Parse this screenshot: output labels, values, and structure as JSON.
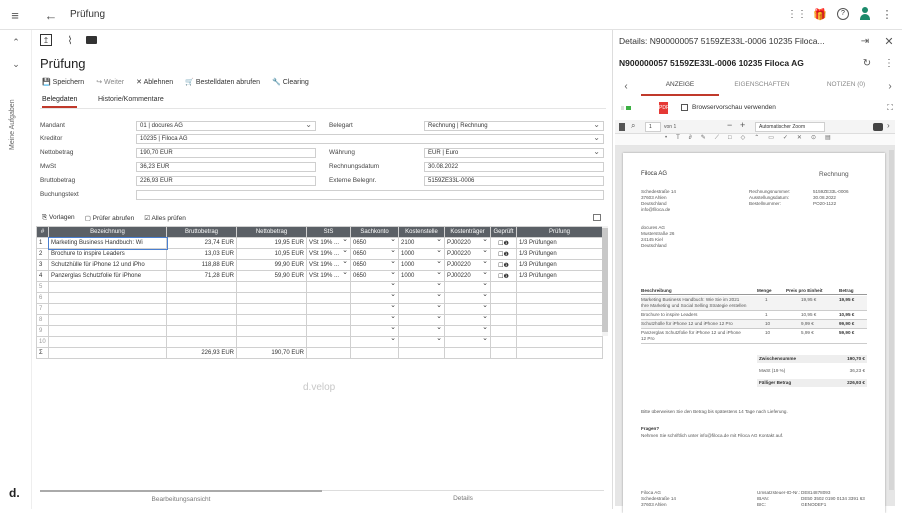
{
  "topbar": {
    "menu_icon": "menu-icon",
    "back_icon": "arrow-left-icon",
    "title": "Prüfung",
    "right_icons": [
      "grid-icon",
      "gift-icon",
      "help-icon",
      "user-icon",
      "more-icon"
    ]
  },
  "rail": {
    "label": "Meine Aufgaben",
    "brand": "d."
  },
  "toolbar": {
    "icons": [
      "export-icon",
      "paperclip-icon",
      "mail-icon"
    ]
  },
  "page": {
    "title": "Prüfung"
  },
  "actions": {
    "save": "Speichern",
    "forward": "Weiter",
    "reject": "Ablehnen",
    "order": "Bestelldaten abrufen",
    "clearing": "Clearing"
  },
  "tabs": {
    "belegdaten": "Belegdaten",
    "historie": "Historie/Kommentare"
  },
  "form": {
    "mandant_label": "Mandant",
    "mandant": "01 | docures AG",
    "kreditor_label": "Kreditor",
    "kreditor": "10235 | Filoca AG",
    "netto_label": "Nettobetrag",
    "netto": "190,70 EUR",
    "mwst_label": "MwSt",
    "mwst": "36,23 EUR",
    "brutto_label": "Bruttobetrag",
    "brutto": "226,93 EUR",
    "buchungstext_label": "Buchungstext",
    "buchungstext": "",
    "belegart_label": "Belegart",
    "belegart": "Rechnung | Rechnung",
    "waehrung_label": "Währung",
    "waehrung": "EUR | Euro",
    "rechnungsdatum_label": "Rechnungsdatum",
    "rechnungsdatum": "30.08.2022",
    "belegnr_label": "Externe Belegnr.",
    "belegnr": "5159ZE33L-0006"
  },
  "grid_toolbar": {
    "vorlagen": "Vorlagen",
    "pruefer": "Prüfer abrufen",
    "alles": "Alles prüfen"
  },
  "grid": {
    "headers": [
      "#",
      "Bezeichnung",
      "Bruttobetrag",
      "Nettobetrag",
      "StS",
      "Sachkonto",
      "Kostenstelle",
      "Kostenträger",
      "Geprüft",
      "Prüfung"
    ],
    "rows": [
      {
        "n": "1",
        "bez": "Marketing Business Handbuch: Wi",
        "brutto": "23,74 EUR",
        "netto": "19,95 EUR",
        "sts": "VSt 19% ...",
        "konto": "0650",
        "kst": "2100",
        "ktr": "PJ00220",
        "pruef": "1/3 Prüfungen"
      },
      {
        "n": "2",
        "bez": "Brochure to inspire Leaders",
        "brutto": "13,03 EUR",
        "netto": "10,95 EUR",
        "sts": "VSt 19% ...",
        "konto": "0650",
        "kst": "1000",
        "ktr": "PJ00220",
        "pruef": "1/3 Prüfungen"
      },
      {
        "n": "3",
        "bez": "Schutzhülle für iPhone 12 und iPho",
        "brutto": "118,88 EUR",
        "netto": "99,90 EUR",
        "sts": "VSt 19% ...",
        "konto": "0650",
        "kst": "1000",
        "ktr": "PJ00220",
        "pruef": "1/3 Prüfungen"
      },
      {
        "n": "4",
        "bez": "Panzerglas Schutzfolie für iPhone",
        "brutto": "71,28 EUR",
        "netto": "59,90 EUR",
        "sts": "VSt 19% ...",
        "konto": "0650",
        "kst": "1000",
        "ktr": "PJ00220",
        "pruef": "1/3 Prüfungen"
      }
    ],
    "empty_rows": [
      "5",
      "6",
      "7",
      "8",
      "9",
      "10"
    ],
    "sum_symbol": "Σ",
    "sum_brutto": "226,93 EUR",
    "sum_netto": "190,70 EUR"
  },
  "watermark": "d.velop",
  "bottom_tabs": {
    "bearbeitung": "Bearbeitungsansicht",
    "details": "Details"
  },
  "details": {
    "header": "Details: N900000057 5159ZE33L-0006 10235 Filoca...",
    "title": "N900000057 5159ZE33L-0006 10235 Filoca AG",
    "tabs": [
      "ANZEIGE",
      "EIGENSCHAFTEN",
      "NOTIZEN (0)"
    ],
    "browser_preview": "Browservorschau verwenden",
    "page_num": "1",
    "page_of": "von 1",
    "zoom": "Automatischer Zoom"
  },
  "pdf": {
    "company": "Filoca AG",
    "doc_type": "Rechnung",
    "addr": [
      "Schedestraße 14",
      "37603 Ahlen",
      "Deutschland",
      "info@filoca.de"
    ],
    "meta_labels": [
      "Rechnungsnummer:",
      "Ausstellungsdatum:",
      "Bestellnummer:"
    ],
    "meta_values": [
      "5159ZE33L-0006",
      "30.08.2022",
      "PO20-1122"
    ],
    "recipient": [
      "docures AG",
      "Musterstraße 26",
      "24145 Kiel",
      "Deutschland"
    ],
    "cols": [
      "Beschreibung",
      "Menge",
      "Preis pro Einheit",
      "Betrag"
    ],
    "items": [
      {
        "d": "Marketing Business Handbuch: Wie Sie im 2021 Ihre Marketing und Social Selling Strategie erstellen",
        "m": "1",
        "p": "19,95 €",
        "b": "19,95 €"
      },
      {
        "d": "Brochure to inspire Leaders",
        "m": "1",
        "p": "10,95 €",
        "b": "10,95 €"
      },
      {
        "d": "Schutzhülle für iPhone 12 und iPhone 12 Pro",
        "m": "10",
        "p": "9,99 €",
        "b": "99,90 €"
      },
      {
        "d": "Panzerglas Schutzfolie für iPhone 12 und iPhone 12 Pro",
        "m": "10",
        "p": "5,99 €",
        "b": "59,90 €"
      }
    ],
    "sub_label": "Zwischensumme",
    "sub": "190,70 €",
    "tax_label": "MwSt (19 %)",
    "tax": "36,23 €",
    "total_label": "Fälliger Betrag",
    "total": "226,93 €",
    "note1": "Bitte überweisen Sie den Betrag bis spätestens 14 Tage nach Lieferung.",
    "q": "Fragen?",
    "note2": "Nehmen Sie schriftlich unter info@filoca.de mit Filoca AG Kontakt auf.",
    "footer": [
      "Filoca AG",
      "Schedestraße 14",
      "37603 Ahlen"
    ],
    "footer_labels": [
      "Umsatzsteuer-ID-Nr.:",
      "IBAN:",
      "BIC:"
    ],
    "footer_values": [
      "DE814878093",
      "DE50 3502 0190 0134 3391 63",
      "GENODEF1"
    ]
  }
}
